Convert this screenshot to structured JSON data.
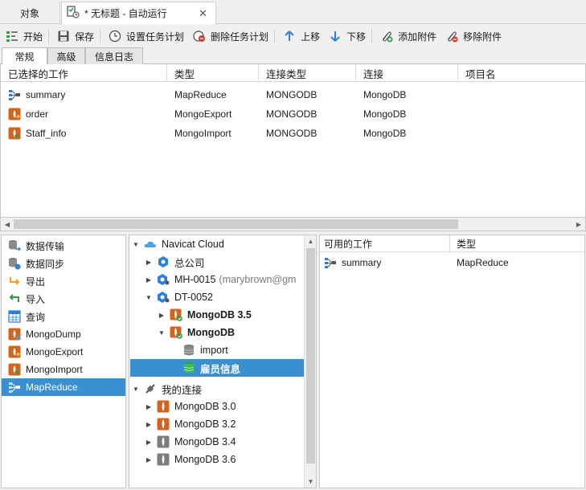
{
  "tabs": {
    "objects": "对象",
    "task": "* 无标题 - 自动运行",
    "close": "✕"
  },
  "toolbar": {
    "start": "开始",
    "save": "保存",
    "set_schedule": "设置任务计划",
    "delete_schedule": "删除任务计划",
    "move_up": "上移",
    "move_down": "下移",
    "add_attachment": "添加附件",
    "remove_attachment": "移除附件"
  },
  "subtabs": {
    "general": "常规",
    "advanced": "高级",
    "log": "信息日志"
  },
  "selected_jobs": {
    "columns": [
      "已选择的工作",
      "类型",
      "连接类型",
      "连接",
      "项目名"
    ],
    "rows": [
      {
        "name": "summary",
        "type": "MapReduce",
        "conn_type": "MONGODB",
        "conn": "MongoDB",
        "icon": "mapreduce-icon"
      },
      {
        "name": "order",
        "type": "MongoExport",
        "conn_type": "MONGODB",
        "conn": "MongoDB",
        "icon": "mongo-export-icon"
      },
      {
        "name": "Staff_info",
        "type": "MongoImport",
        "conn_type": "MONGODB",
        "conn": "MongoDB",
        "icon": "mongo-import-icon"
      }
    ]
  },
  "job_types": [
    {
      "label": "数据传输",
      "icon": "data-transfer-icon"
    },
    {
      "label": "数据同步",
      "icon": "data-sync-icon"
    },
    {
      "label": "导出",
      "icon": "export-icon"
    },
    {
      "label": "导入",
      "icon": "import-icon"
    },
    {
      "label": "查询",
      "icon": "query-icon"
    },
    {
      "label": "MongoDump",
      "icon": "mongo-dump-icon"
    },
    {
      "label": "MongoExport",
      "icon": "mongo-export-icon"
    },
    {
      "label": "MongoImport",
      "icon": "mongo-import-icon"
    },
    {
      "label": "MapReduce",
      "icon": "mapreduce-icon",
      "selected": true
    }
  ],
  "tree": {
    "cloud": "Navicat Cloud",
    "company": "总公司",
    "mh_project": "MH-0015",
    "mh_owner": "(marybrown@gm",
    "dt_project": "DT-0052",
    "mongo35": "MongoDB 3.5",
    "mongo": "MongoDB",
    "db_import": "import",
    "db_staff": "雇员信息",
    "my_conn": "我的连接",
    "mongo30": "MongoDB 3.0",
    "mongo32": "MongoDB 3.2",
    "mongo34": "MongoDB 3.4",
    "mongo36": "MongoDB 3.6"
  },
  "available_jobs": {
    "columns": [
      "可用的工作",
      "类型"
    ],
    "rows": [
      {
        "name": "summary",
        "type": "MapReduce"
      }
    ]
  },
  "colors": {
    "selection": "#3a8fd1",
    "mongo_orange": "#d3641f",
    "green": "#2ea043",
    "blue": "#2f7fd6"
  }
}
